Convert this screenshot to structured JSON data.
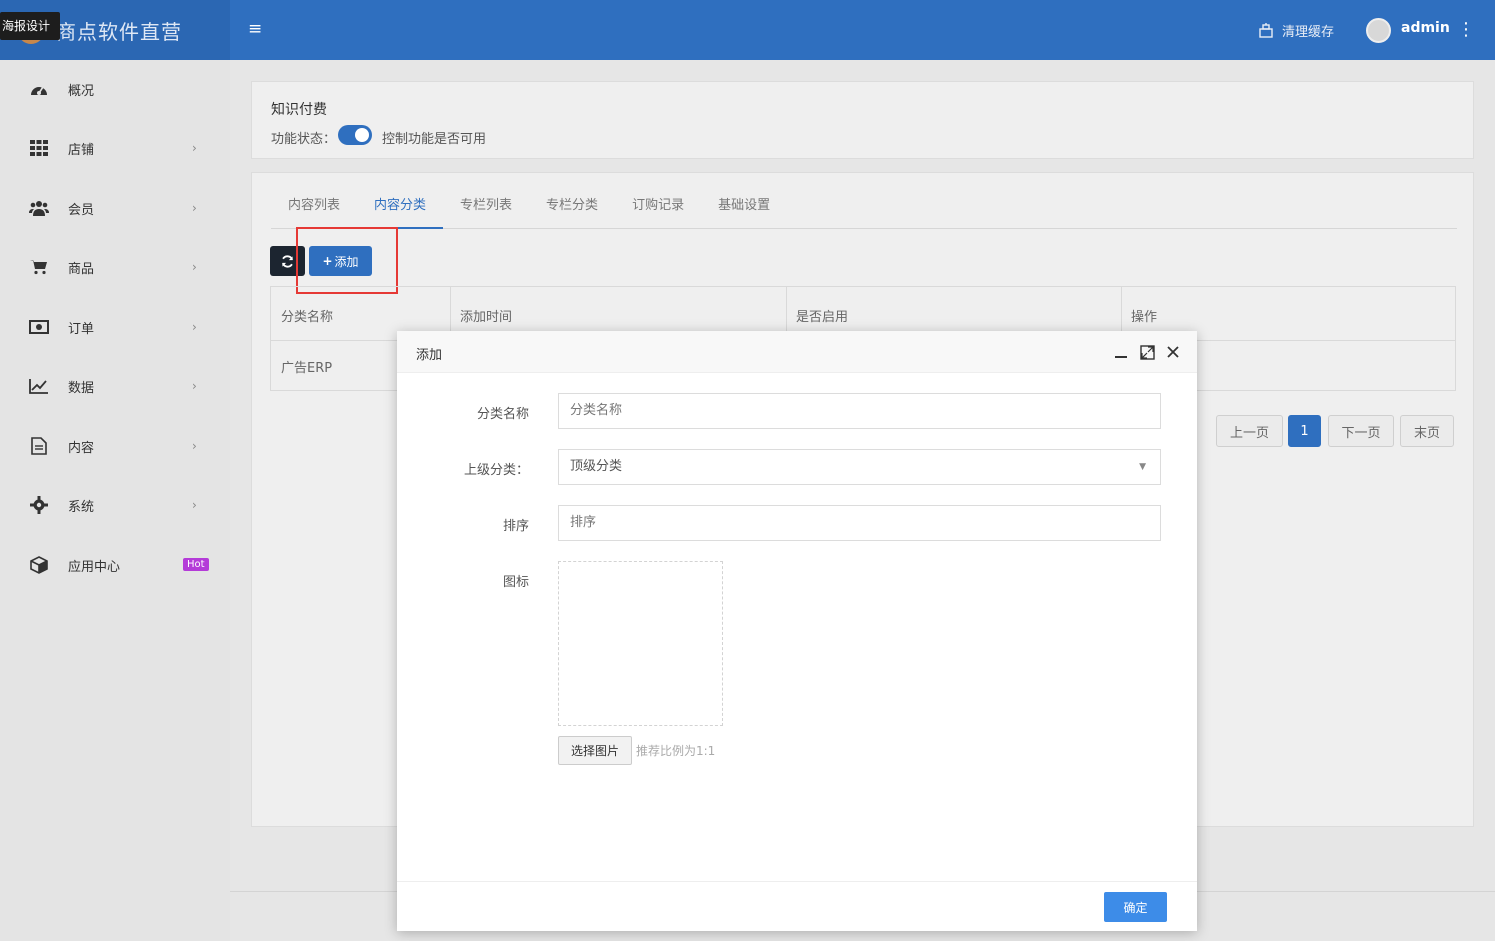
{
  "header": {
    "brand_title": "商点软件直营",
    "poster_tag": "海报设计",
    "clear_cache": "清理缓存",
    "user_name": "admin"
  },
  "sidebar": {
    "items": [
      {
        "label": "概况",
        "icon": "dashboard-icon"
      },
      {
        "label": "店铺",
        "icon": "grid-icon"
      },
      {
        "label": "会员",
        "icon": "users-icon"
      },
      {
        "label": "商品",
        "icon": "cart-icon"
      },
      {
        "label": "订单",
        "icon": "money-icon"
      },
      {
        "label": "数据",
        "icon": "line-chart-icon"
      },
      {
        "label": "内容",
        "icon": "file-icon"
      },
      {
        "label": "系统",
        "icon": "gear-icon"
      },
      {
        "label": "应用中心",
        "icon": "cube-icon",
        "badge": "Hot"
      }
    ]
  },
  "feature": {
    "title": "知识付费",
    "status_label": "功能状态：",
    "status_desc": "控制功能是否可用"
  },
  "tabs": [
    "内容列表",
    "内容分类",
    "专栏列表",
    "专栏分类",
    "订购记录",
    "基础设置"
  ],
  "toolbar": {
    "add_label": "添加"
  },
  "table": {
    "headers": [
      "分类名称",
      "添加时间",
      "是否启用",
      "操作"
    ],
    "rows": [
      [
        "广告ERP"
      ]
    ]
  },
  "pager": {
    "prev": "上一页",
    "current": "1",
    "next": "下一页",
    "last": "末页"
  },
  "modal": {
    "title": "添加",
    "name_label": "分类名称",
    "name_placeholder": "分类名称",
    "parent_label": "上级分类：",
    "parent_value": "顶级分类",
    "sort_label": "排序",
    "sort_placeholder": "排序",
    "icon_label": "图标",
    "choose_image": "选择图片",
    "hint": "推荐比例为1:1",
    "confirm": "确定"
  },
  "colors": {
    "header": "#2f6fbf",
    "accent": "#2f6fbf",
    "hot": "#b43bd8",
    "confirm": "#3d8ce8"
  }
}
